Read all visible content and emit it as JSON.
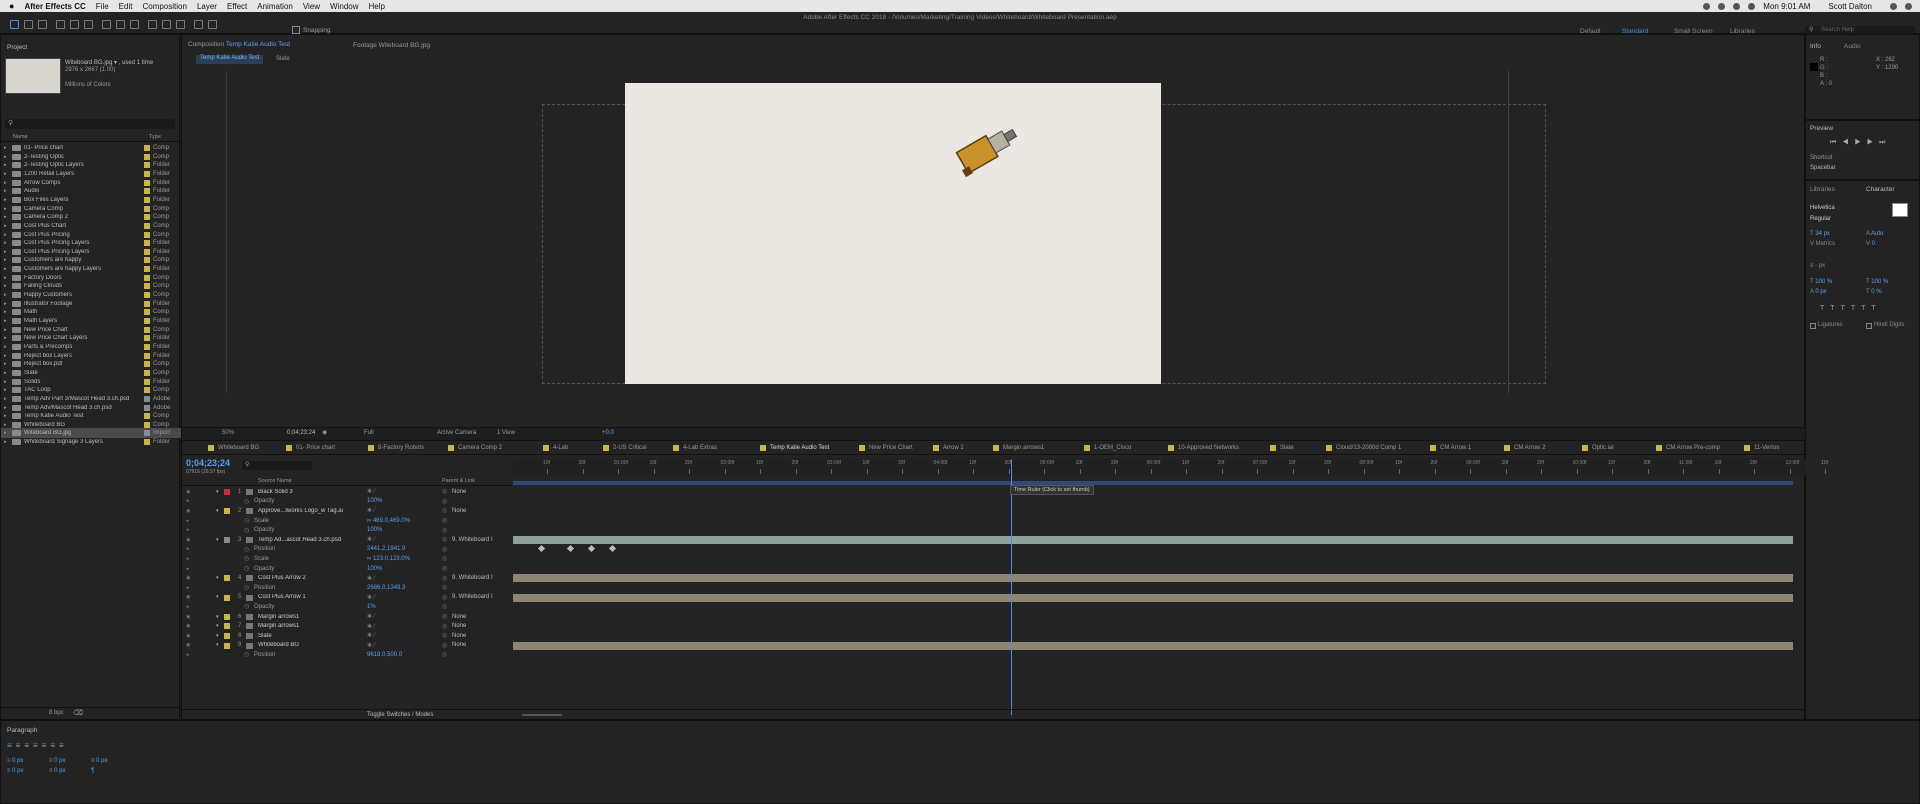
{
  "menubar": {
    "apple": "",
    "app": "After Effects CC",
    "items": [
      "File",
      "Edit",
      "Composition",
      "Layer",
      "Effect",
      "Animation",
      "View",
      "Window",
      "Help"
    ],
    "clock": "Mon 9:01 AM",
    "user": "Scott Dalton"
  },
  "titlebar": {
    "title": "Adobe After Effects CC 2018 - /Volumes/Marketing/Training Videos/Whiteboard/Whiteboard Presentation.aep",
    "snapping": "Snapping",
    "workspaces": [
      "Default",
      "Standard",
      "Small Screen",
      "Libraries"
    ],
    "search_placeholder": "Search Help"
  },
  "project": {
    "title": "Project",
    "asset_name": "Witeboard BG.jpg ▾ , used 1 time",
    "asset_dims": "2976 x 2667 (1.00)",
    "asset_colors": "Millions of Colors",
    "col_name": "Name",
    "col_type": "Type",
    "bpc": "8 bpc",
    "items": [
      {
        "name": "01- Price chart",
        "type": "Comp",
        "color": "#c9b54a"
      },
      {
        "name": "2-Testing Optic",
        "type": "Comp",
        "color": "#c9b54a"
      },
      {
        "name": "2-Testing Optic Layers",
        "type": "Folder",
        "color": "#c9b54a"
      },
      {
        "name": "1200 Retail Layers",
        "type": "Folder",
        "color": "#c9b54a"
      },
      {
        "name": "Arrow Comps",
        "type": "Folder",
        "color": "#c9b54a"
      },
      {
        "name": "Audio",
        "type": "Folder",
        "color": "#c9b54a"
      },
      {
        "name": "Box Files Layers",
        "type": "Folder",
        "color": "#c9b54a"
      },
      {
        "name": "Camera Comp",
        "type": "Comp",
        "color": "#c9b54a"
      },
      {
        "name": "Camera Comp 2",
        "type": "Comp",
        "color": "#c9b54a"
      },
      {
        "name": "Cost Plus Chart",
        "type": "Comp",
        "color": "#c9b54a"
      },
      {
        "name": "Cost Plus Pricing",
        "type": "Comp",
        "color": "#c9b54a"
      },
      {
        "name": "Cost Plus Pricing Layers",
        "type": "Folder",
        "color": "#c9b54a"
      },
      {
        "name": "Cost Plus Pricing Layers",
        "type": "Folder",
        "color": "#c9b54a"
      },
      {
        "name": "Customers are happy",
        "type": "Comp",
        "color": "#c9b54a"
      },
      {
        "name": "Customers are happy Layers",
        "type": "Folder",
        "color": "#c9b54a"
      },
      {
        "name": "Factory Doors",
        "type": "Comp",
        "color": "#c9b54a"
      },
      {
        "name": "Falling Clouds",
        "type": "Comp",
        "color": "#c9b54a"
      },
      {
        "name": "Happy Customers",
        "type": "Comp",
        "color": "#c9b54a"
      },
      {
        "name": "Illustrator Footage",
        "type": "Folder",
        "color": "#c9b54a"
      },
      {
        "name": "Math",
        "type": "Comp",
        "color": "#c9b54a"
      },
      {
        "name": "Math Layers",
        "type": "Folder",
        "color": "#c9b54a"
      },
      {
        "name": "New Price Chart",
        "type": "Comp",
        "color": "#c9b54a"
      },
      {
        "name": "New Price Chart Layers",
        "type": "Folder",
        "color": "#c9b54a"
      },
      {
        "name": "Parts & Precomps",
        "type": "Folder",
        "color": "#c9b54a"
      },
      {
        "name": "Reject box Layers",
        "type": "Folder",
        "color": "#c9b54a"
      },
      {
        "name": "Reject box.pdf",
        "type": "Comp",
        "color": "#c9b54a"
      },
      {
        "name": "Slate",
        "type": "Comp",
        "color": "#c9b54a"
      },
      {
        "name": "Solids",
        "type": "Folder",
        "color": "#c9b54a"
      },
      {
        "name": "TAC Loop",
        "type": "Comp",
        "color": "#c9b54a"
      },
      {
        "name": "Temp Adv Part 3/Mascot Head 3.ch.psd",
        "type": "Adobe",
        "color": "#8a8a8a"
      },
      {
        "name": "Temp Adv/Mascot Head 3.ch.psd",
        "type": "Adobe",
        "color": "#8a8a8a"
      },
      {
        "name": "Temp Katie Audio Test",
        "type": "Comp",
        "color": "#c9b54a"
      },
      {
        "name": "Whiteboard BG",
        "type": "Comp",
        "color": "#c9b54a"
      },
      {
        "name": "Witeboard BG.jpg",
        "type": "Import",
        "color": "#8a8a8a"
      },
      {
        "name": "Whiteboard Signage 3 Layers",
        "type": "Folder",
        "color": "#c9b54a"
      }
    ]
  },
  "viewer": {
    "tabs": [
      {
        "label": "Composition",
        "name": "Temp Katie Audio Test"
      },
      {
        "label": "Footage Witeboard BG.jpg"
      }
    ],
    "subtabs": [
      "Temp Katie Audio Test",
      "Slate"
    ],
    "zoom": "50%",
    "timecode": "0;04;23;24",
    "resolution": "Full",
    "camera": "Active Camera",
    "views": "1 View",
    "exposure": "+0.0"
  },
  "timeline": {
    "timecode": "0;04;23;24",
    "fps": "07916 (29.97 fps)",
    "toggle": "Toggle Switches / Modes",
    "tooltip": "Time Ruler (Click to set thumb)",
    "tabs": [
      "Whiteboard BG",
      "01- Price chart",
      "8-Factory Robots",
      "Camera Comp 2",
      "4-Lab",
      "2-US Critical",
      "4-Lab Extras",
      "Temp Katie Audio Test",
      "New Price Chart",
      "Arrow 1",
      "Margin arrows1",
      "1-OEM_Cisco",
      "10-Approved Networks",
      "Slate",
      "Cloud/13-2000d Comp 1",
      "CM Arrow 1",
      "CM Arrow 2",
      "Optic.ial",
      "CM Arrow Pre-comp",
      "11-Vertos"
    ],
    "col_source": "Source Name",
    "col_parent": "Parent & Link",
    "ticks": [
      "10f",
      "20f",
      "01:00f",
      "10f",
      "20f",
      "02:00f",
      "10f",
      "20f",
      "03:00f",
      "10f",
      "20f",
      "04:00f",
      "10f",
      "20f",
      "05:00f",
      "10f",
      "20f",
      "06:00f",
      "10f",
      "20f",
      "07:00f",
      "10f",
      "20f",
      "08:00f",
      "10f",
      "20f",
      "09:00f",
      "10f",
      "20f",
      "10:00f",
      "10f",
      "20f",
      "11:00f",
      "10f",
      "20f",
      "12:00f",
      "10f"
    ],
    "layers": [
      {
        "num": "1",
        "name": "Black Solid 3",
        "parent": "None",
        "color": "#c03535",
        "kind": "layer"
      },
      {
        "prop": "Opacity",
        "val": "100%",
        "kind": "prop"
      },
      {
        "num": "2",
        "name": "Approve...tworks Logo_w Tag.ai",
        "parent": "None",
        "color": "#c9b54a",
        "kind": "layer"
      },
      {
        "prop": "Scale",
        "val": "∞ 469.0,469.0%",
        "kind": "prop"
      },
      {
        "prop": "Opacity",
        "val": "100%",
        "kind": "prop"
      },
      {
        "num": "3",
        "name": "Temp Ad...ascot Head 3.ch.psd",
        "parent": "9. Whiteboard I",
        "color": "#8a8a8a",
        "kind": "layer"
      },
      {
        "prop": "Position",
        "val": "2441.2,1941.9",
        "kind": "prop"
      },
      {
        "prop": "Scale",
        "val": "∞ 123.0,123.0%",
        "kind": "prop"
      },
      {
        "prop": "Opacity",
        "val": "100%",
        "kind": "prop"
      },
      {
        "num": "4",
        "name": "Cost Plus Arrow 2",
        "parent": "9. Whiteboard I",
        "color": "#c9b54a",
        "kind": "layer"
      },
      {
        "prop": "Position",
        "val": "2686.0,1349.3",
        "kind": "prop"
      },
      {
        "num": "5",
        "name": "Cost Plus Arrow 1",
        "parent": "9. Whiteboard I",
        "color": "#c9b54a",
        "kind": "layer"
      },
      {
        "prop": "Opacity",
        "val": "1%",
        "kind": "prop"
      },
      {
        "num": "6",
        "name": "Margin arrows1",
        "parent": "None",
        "color": "#c9b54a",
        "kind": "layer"
      },
      {
        "num": "7",
        "name": "Margin arrows1",
        "parent": "None",
        "color": "#c9b54a",
        "kind": "layer"
      },
      {
        "num": "8",
        "name": "Slate",
        "parent": "None",
        "color": "#c9b54a",
        "kind": "layer"
      },
      {
        "num": "9",
        "name": "Whiteboard BG",
        "parent": "None",
        "color": "#c9b54a",
        "kind": "layer"
      },
      {
        "prop": "Position",
        "val": "9618.0,500.0",
        "kind": "prop"
      }
    ]
  },
  "info": {
    "tabs": [
      "Info",
      "Audio"
    ],
    "r": "R :",
    "g": "G :",
    "b": "B :",
    "a": "A : 0",
    "x": "X : 262",
    "y": "Y : 1290"
  },
  "preview": {
    "title": "Preview",
    "shortcut_label": "Shortcut",
    "shortcut": "Spacebar"
  },
  "character": {
    "tabs": [
      "Libraries",
      "Character"
    ],
    "font": "Helvetica",
    "style": "Regular",
    "size": "34 px",
    "leading": "Auto",
    "kerning": "Metrics",
    "tracking": "0",
    "stroke": "- px",
    "vscale": "100 %",
    "hscale": "100 %",
    "baseline": "0 px",
    "tsume": "0 %",
    "ligatures": "Ligatures",
    "hindi": "Hindi Digits"
  },
  "paragraph": {
    "title": "Paragraph",
    "a": "0 px",
    "b": "0 px",
    "c": "0 px",
    "d": "0 px",
    "e": "0 px"
  }
}
